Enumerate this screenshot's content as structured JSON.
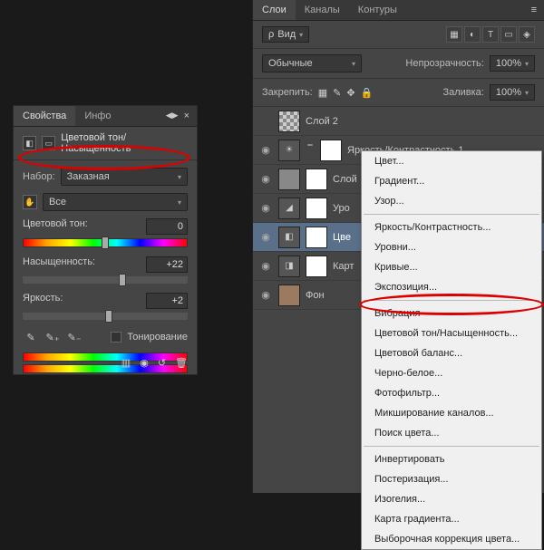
{
  "props_panel": {
    "tab_props": "Свойства",
    "tab_info": "Инфо",
    "title": "Цветовой тон/Насыщенность",
    "preset_label": "Набор:",
    "preset_value": "Заказная",
    "channel_value": "Все",
    "hue_label": "Цветовой тон:",
    "hue_value": "0",
    "sat_label": "Насыщенность:",
    "sat_value": "+22",
    "light_label": "Яркость:",
    "light_value": "+2",
    "colorize_label": "Тонирование"
  },
  "layers_panel": {
    "tab_layers": "Слои",
    "tab_channels": "Каналы",
    "tab_paths": "Контуры",
    "kind_label": "Вид",
    "blend_mode": "Обычные",
    "opacity_label": "Непрозрачность:",
    "opacity_value": "100%",
    "lock_label": "Закрепить:",
    "fill_label": "Заливка:",
    "fill_value": "100%",
    "layers": [
      {
        "name": "Слой 2"
      },
      {
        "name": "Яркость/Контрастность 1"
      },
      {
        "name": "Слой"
      },
      {
        "name": "Уро"
      },
      {
        "name": "Цве"
      },
      {
        "name": "Карт"
      },
      {
        "name": "Фон"
      }
    ]
  },
  "context_menu": {
    "items_g1": [
      "Цвет...",
      "Градиент...",
      "Узор..."
    ],
    "items_g2": [
      "Яркость/Контрастность...",
      "Уровни...",
      "Кривые...",
      "Экспозиция..."
    ],
    "items_g3": [
      "Вибрация",
      "Цветовой тон/Насыщенность...",
      "Цветовой баланс...",
      "Черно-белое...",
      "Фотофильтр...",
      "Микширование каналов...",
      "Поиск цвета..."
    ],
    "items_g4": [
      "Инвертировать",
      "Постеризация...",
      "Изогелия...",
      "Карта градиента...",
      "Выборочная коррекция цвета..."
    ]
  }
}
